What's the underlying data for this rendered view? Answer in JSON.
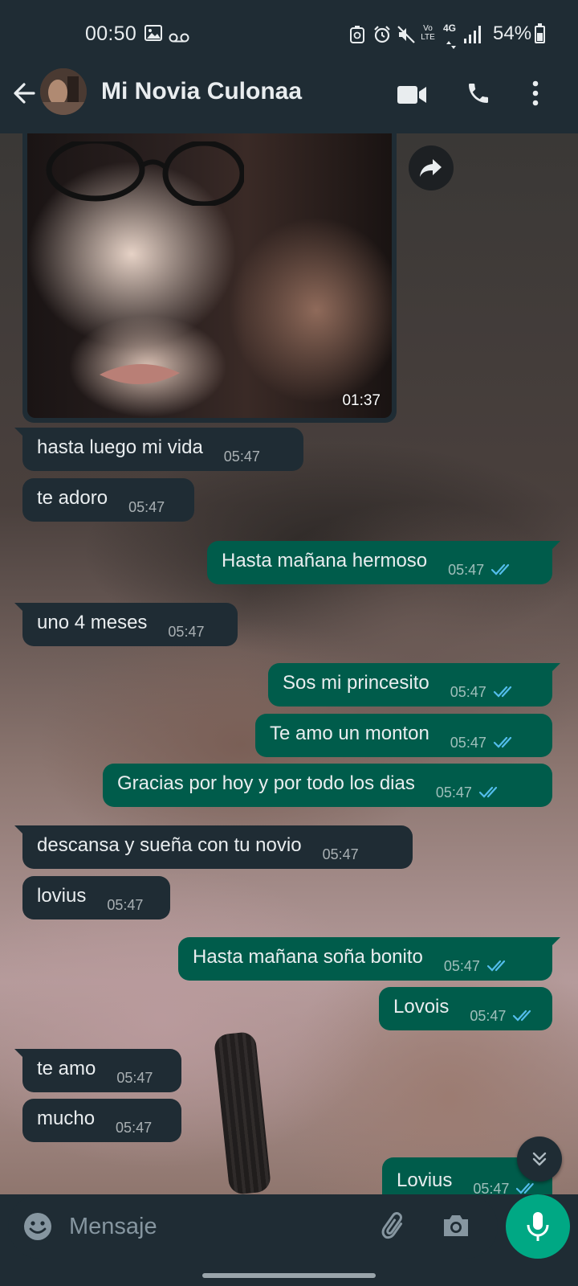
{
  "status_bar": {
    "time": "00:50",
    "network": "4G",
    "volte": "Vo LTE",
    "battery": "54%",
    "icons": [
      "gallery-icon",
      "voicemail-icon",
      "recycle-icon",
      "alarm-icon",
      "mute-icon",
      "volte-icon",
      "network-4g-icon",
      "signal-icon",
      "battery-icon"
    ]
  },
  "header": {
    "contact_name": "Mi Novia Culonaa",
    "icons": [
      "back-arrow-icon",
      "video-call-icon",
      "phone-icon",
      "more-vert-icon"
    ]
  },
  "image_message": {
    "time": "01:37"
  },
  "messages": [
    {
      "direction": "in",
      "text": "hasta luego mi vida",
      "time": "05:47"
    },
    {
      "direction": "in",
      "text": "te adoro",
      "time": "05:47"
    },
    {
      "direction": "out",
      "text": "Hasta mañana hermoso",
      "time": "05:47",
      "status": "read"
    },
    {
      "direction": "in",
      "text": "uno 4 meses",
      "time": "05:47"
    },
    {
      "direction": "out",
      "text": "Sos mi princesito",
      "time": "05:47",
      "status": "read"
    },
    {
      "direction": "out",
      "text": "Te amo un monton",
      "time": "05:47",
      "status": "read"
    },
    {
      "direction": "out",
      "text": "Gracias por hoy y por todo los dias",
      "time": "05:47",
      "status": "read"
    },
    {
      "direction": "in",
      "text": "descansa y sueña con tu novio",
      "time": "05:47"
    },
    {
      "direction": "in",
      "text": "lovius",
      "time": "05:47"
    },
    {
      "direction": "out",
      "text": "Hasta mañana soña bonito",
      "time": "05:47",
      "status": "read"
    },
    {
      "direction": "out",
      "text": "Lovois",
      "time": "05:47",
      "status": "read"
    },
    {
      "direction": "in",
      "text": "te amo",
      "time": "05:47"
    },
    {
      "direction": "in",
      "text": "mucho",
      "time": "05:47"
    },
    {
      "direction": "out",
      "text": "Lovius",
      "time": "05:47",
      "status": "read"
    }
  ],
  "input": {
    "placeholder": "Mensaje"
  },
  "colors": {
    "incoming_bubble": "#1f2c34",
    "outgoing_bubble": "#005c4b",
    "read_ticks": "#53bdeb",
    "accent": "#00a884",
    "bars": "#1f2c34"
  }
}
